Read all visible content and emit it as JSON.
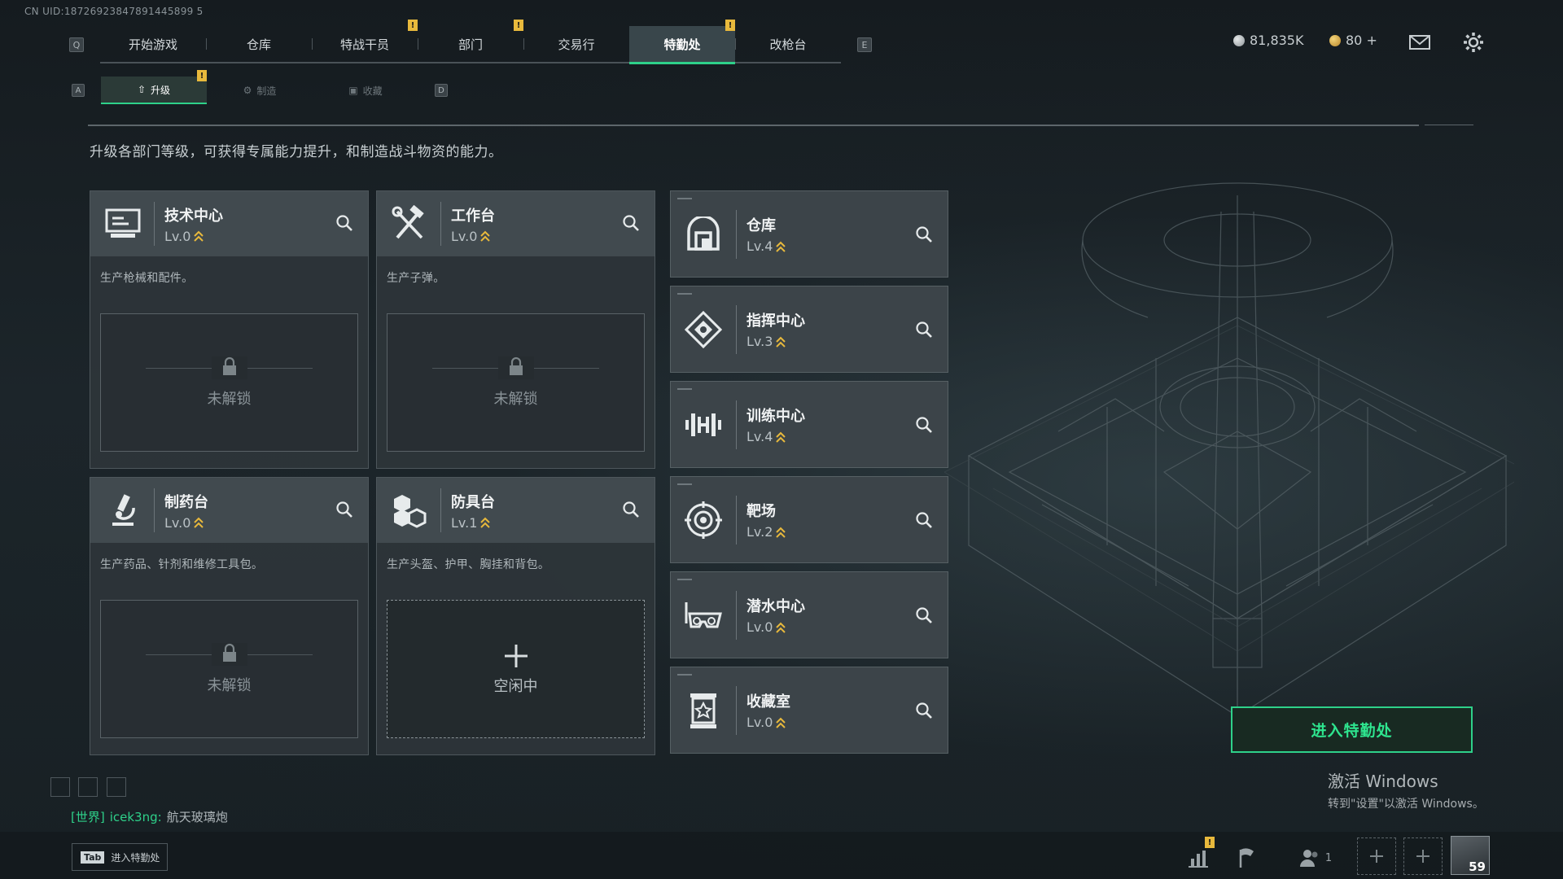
{
  "uid": "CN UID:18726923847891445899 5",
  "nav": {
    "left_key": "Q",
    "right_key": "E",
    "tabs": [
      {
        "label": "开始游戏",
        "alert": false,
        "active": false
      },
      {
        "label": "仓库",
        "alert": false,
        "active": false
      },
      {
        "label": "特战干员",
        "alert": true,
        "active": false
      },
      {
        "label": "部门",
        "alert": true,
        "active": false
      },
      {
        "label": "交易行",
        "alert": false,
        "active": false
      },
      {
        "label": "特勤处",
        "alert": true,
        "active": true
      },
      {
        "label": "改枪台",
        "alert": false,
        "active": false
      }
    ],
    "alert_mark": "!"
  },
  "currency": {
    "hafcoin": "81,835K",
    "premium": "80 +"
  },
  "subnav": {
    "left_key": "A",
    "right_key": "D",
    "tabs": [
      {
        "label": "升级",
        "active": true,
        "alert": true
      },
      {
        "label": "制造",
        "active": false,
        "alert": false
      },
      {
        "label": "收藏",
        "active": false,
        "alert": false
      }
    ]
  },
  "description": "升级各部门等级，可获得专属能力提升，和制造战斗物资的能力。",
  "cards": [
    {
      "title": "技术中心",
      "level": "Lv.0",
      "desc": "生产枪械和配件。",
      "slot": "未解锁",
      "icon": "computer-icon"
    },
    {
      "title": "工作台",
      "level": "Lv.0",
      "desc": "生产子弹。",
      "slot": "未解锁",
      "icon": "tools-icon"
    },
    {
      "title": "制药台",
      "level": "Lv.0",
      "desc": "生产药品、针剂和维修工具包。",
      "slot": "未解锁",
      "icon": "microscope-icon"
    },
    {
      "title": "防具台",
      "level": "Lv.1",
      "desc": "生产头盔、护甲、胸挂和背包。",
      "slot": "空闲中",
      "icon": "boxes-icon"
    }
  ],
  "facilities": [
    {
      "title": "仓库",
      "level": "Lv.4",
      "icon": "vault-icon"
    },
    {
      "title": "指挥中心",
      "level": "Lv.3",
      "icon": "command-icon"
    },
    {
      "title": "训练中心",
      "level": "Lv.4",
      "icon": "dumbbell-icon"
    },
    {
      "title": "靶场",
      "level": "Lv.2",
      "icon": "target-icon"
    },
    {
      "title": "潜水中心",
      "level": "Lv.0",
      "icon": "goggles-icon"
    },
    {
      "title": "收藏室",
      "level": "Lv.0",
      "icon": "trophy-icon"
    }
  ],
  "enter_button": "进入特勤处",
  "windows_activation": {
    "title": "激活 Windows",
    "subtitle": "转到\"设置\"以激活 Windows。"
  },
  "chat": {
    "channel": "[世界]",
    "user": "icek3ng:",
    "message": "航天玻璃炮"
  },
  "tab_hint": {
    "key": "Tab",
    "label": "进入特勤处"
  },
  "social": {
    "friends_count": "1"
  },
  "player_level": "59",
  "colors": {
    "accent": "#2ed18a",
    "alert": "#e8b93c"
  }
}
